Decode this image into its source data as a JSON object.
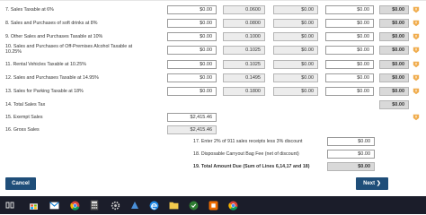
{
  "form": {
    "rows": [
      {
        "label": "7. Sales Taxable at 6%",
        "amount": "$0.00",
        "rate": "0.0600",
        "tax": "$0.00",
        "deduction": "$0.00",
        "total": "$0.00"
      },
      {
        "label": "8. Sales and Purchases of soft drinks at 8%",
        "amount": "$0.00",
        "rate": "0.0800",
        "tax": "$0.00",
        "deduction": "$0.00",
        "total": "$0.00"
      },
      {
        "label": "9. Other Sales and Purchases Taxable at 10%",
        "amount": "$0.00",
        "rate": "0.1000",
        "tax": "$0.00",
        "deduction": "$0.00",
        "total": "$0.00"
      },
      {
        "label": "10. Sales and Purchases of Off-Premises Alcohol Taxable at 10.25%",
        "amount": "$0.00",
        "rate": "0.1025",
        "tax": "$0.00",
        "deduction": "$0.00",
        "total": "$0.00"
      },
      {
        "label": "11. Rental Vehicles Taxable at 10.25%",
        "amount": "$0.00",
        "rate": "0.1025",
        "tax": "$0.00",
        "deduction": "$0.00",
        "total": "$0.00"
      },
      {
        "label": "12. Sales and Purchases Taxable at 14.95%",
        "amount": "$0.00",
        "rate": "0.1495",
        "tax": "$0.00",
        "deduction": "$0.00",
        "total": "$0.00"
      },
      {
        "label": "13. Sales for Parking Taxable at 18%",
        "amount": "$0.00",
        "rate": "0.1800",
        "tax": "$0.00",
        "deduction": "$0.00",
        "total": "$0.00"
      }
    ],
    "total_sales_tax": {
      "label": "14. Total Sales Tax",
      "total": "$0.00"
    },
    "exempt_sales": {
      "label": "15. Exempt Sales",
      "value": "$2,415.46"
    },
    "gross_sales": {
      "label": "16. Gross Sales",
      "value": "$2,415.46"
    },
    "line17": {
      "label": "17. Enter 2% of 911 sales receipts less 3% discount",
      "value": "$0.00"
    },
    "line18": {
      "label": "18. Disposable Carryout Bag Fee (net of discount)",
      "value": "$0.00"
    },
    "line19": {
      "label": "19. Total Amount Due (Sum of Lines 6,14,17 and 18)",
      "value": "$0.00"
    }
  },
  "buttons": {
    "cancel": "Cancel",
    "next": "Next"
  },
  "colors": {
    "primary_button": "#1f4e79",
    "warning": "#f0ad4e",
    "taskbar": "#1b1d2a"
  },
  "taskbar": {
    "icons": [
      "task-view-icon",
      "store-icon",
      "mail-icon",
      "chrome-icon",
      "calculator-icon",
      "settings-icon",
      "app-icon",
      "edge-icon",
      "explorer-icon",
      "green-app-icon",
      "orange-app-icon",
      "chrome-icon-2"
    ]
  }
}
